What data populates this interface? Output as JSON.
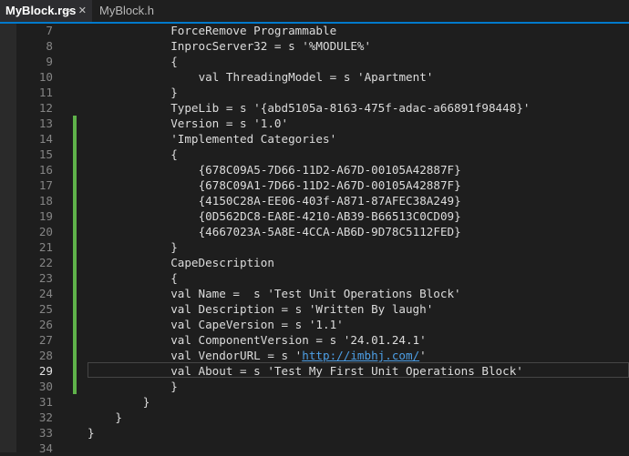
{
  "tabs": [
    {
      "label": "MyBlock.rgs",
      "active": true
    },
    {
      "label": "MyBlock.h",
      "active": false
    }
  ],
  "tab_icons": {
    "pin": "⊸",
    "close": "✕"
  },
  "current_line": 29,
  "changed_lines": [
    13,
    14,
    15,
    16,
    17,
    18,
    19,
    20,
    21,
    22,
    23,
    24,
    25,
    26,
    27,
    28,
    29,
    30
  ],
  "lines": [
    {
      "n": "7",
      "indent": 12,
      "text": "ForceRemove Programmable"
    },
    {
      "n": "8",
      "indent": 12,
      "text": "InprocServer32 = s '%MODULE%'"
    },
    {
      "n": "9",
      "indent": 12,
      "text": "{"
    },
    {
      "n": "10",
      "indent": 16,
      "text": "val ThreadingModel = s 'Apartment'"
    },
    {
      "n": "11",
      "indent": 12,
      "text": "}"
    },
    {
      "n": "12",
      "indent": 12,
      "text": "TypeLib = s '{abd5105a-8163-475f-adac-a66891f98448}'"
    },
    {
      "n": "13",
      "indent": 12,
      "text": "Version = s '1.0'"
    },
    {
      "n": "14",
      "indent": 12,
      "text": "'Implemented Categories'"
    },
    {
      "n": "15",
      "indent": 12,
      "text": "{"
    },
    {
      "n": "16",
      "indent": 16,
      "text": "{678C09A5-7D66-11D2-A67D-00105A42887F}"
    },
    {
      "n": "17",
      "indent": 16,
      "text": "{678C09A1-7D66-11D2-A67D-00105A42887F}"
    },
    {
      "n": "18",
      "indent": 16,
      "text": "{4150C28A-EE06-403f-A871-87AFEC38A249}"
    },
    {
      "n": "19",
      "indent": 16,
      "text": "{0D562DC8-EA8E-4210-AB39-B66513C0CD09}"
    },
    {
      "n": "20",
      "indent": 16,
      "text": "{4667023A-5A8E-4CCA-AB6D-9D78C5112FED}"
    },
    {
      "n": "21",
      "indent": 12,
      "text": "}"
    },
    {
      "n": "22",
      "indent": 12,
      "text": "CapeDescription"
    },
    {
      "n": "23",
      "indent": 12,
      "text": "{"
    },
    {
      "n": "24",
      "indent": 12,
      "text": "val Name =  s 'Test Unit Operations Block'"
    },
    {
      "n": "25",
      "indent": 12,
      "text": "val Description = s 'Written By laugh'"
    },
    {
      "n": "26",
      "indent": 12,
      "text": "val CapeVersion = s '1.1'"
    },
    {
      "n": "27",
      "indent": 12,
      "text": "val ComponentVersion = s '24.01.24.1'"
    },
    {
      "n": "28",
      "indent": 12,
      "text": "val VendorURL = s '",
      "link": "http://imbhj.com/",
      "after": "'"
    },
    {
      "n": "29",
      "indent": 12,
      "text": "val About = s 'Test My First Unit Operations Block'"
    },
    {
      "n": "30",
      "indent": 12,
      "text": "}"
    },
    {
      "n": "31",
      "indent": 8,
      "text": "}"
    },
    {
      "n": "32",
      "indent": 4,
      "text": "}"
    },
    {
      "n": "33",
      "indent": 0,
      "text": "}"
    },
    {
      "n": "34",
      "indent": 0,
      "text": ""
    }
  ]
}
